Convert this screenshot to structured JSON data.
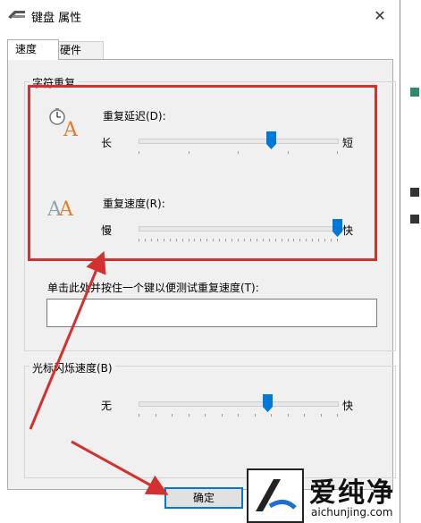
{
  "window": {
    "title": "键盘 属性",
    "close_glyph": "✕"
  },
  "tabs": [
    {
      "label": "速度",
      "active": true
    },
    {
      "label": "硬件",
      "active": false
    }
  ],
  "char_repeat": {
    "group_label": "字符重复",
    "delay": {
      "label": "重复延迟(D):",
      "left": "长",
      "right": "短",
      "value_fraction": 0.67,
      "ticks": 4
    },
    "rate": {
      "label": "重复速度(R):",
      "left": "慢",
      "right": "快",
      "value_fraction": 1.0,
      "ticks": 32
    },
    "test_label": "单击此处并按住一个键以便测试重复速度(T):",
    "test_value": ""
  },
  "cursor_blink": {
    "group_label": "光标闪烁速度(B)",
    "left": "无",
    "right": "快",
    "value_fraction": 0.65,
    "ticks": 12
  },
  "buttons": {
    "ok": "确定"
  },
  "watermark": {
    "text": "爱纯净",
    "url": "aichunjing.com"
  },
  "colors": {
    "accent": "#0078d7",
    "annotation": "#d33030"
  }
}
